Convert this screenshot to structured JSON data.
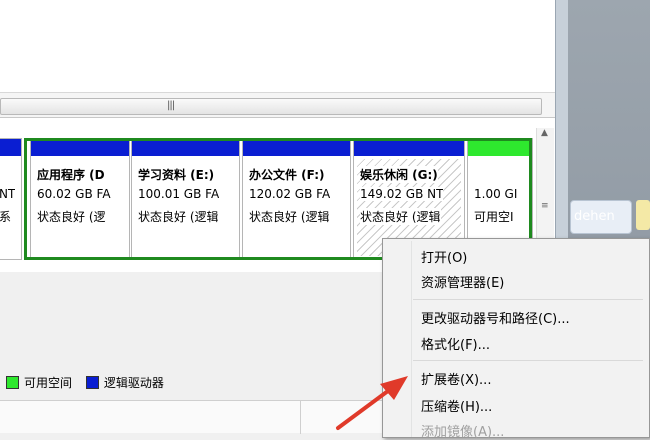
{
  "scrollbar": {
    "grip": "|||"
  },
  "partitions": [
    {
      "name": "",
      "size": "NT",
      "status": "系",
      "bar": "blue",
      "hatched": false
    },
    {
      "name": "应用程序 (D",
      "size": "60.02 GB FA",
      "status": "状态良好 (逻",
      "bar": "blue",
      "hatched": false
    },
    {
      "name": "学习资料 (E:)",
      "size": "100.01 GB FA",
      "status": "状态良好 (逻辑",
      "bar": "blue",
      "hatched": false
    },
    {
      "name": "办公文件 (F:)",
      "size": "120.02 GB FA",
      "status": "状态良好 (逻辑",
      "bar": "blue",
      "hatched": false
    },
    {
      "name": "娱乐休闲 (G:)",
      "size": "149.02 GB NT",
      "status": "状态良好 (逻辑",
      "bar": "blue",
      "hatched": true
    },
    {
      "name": "",
      "size": "1.00 GI",
      "status": "可用空I",
      "bar": "green",
      "hatched": false
    }
  ],
  "legend": {
    "free_space": "可用空间",
    "logical_drive": "逻辑驱动器"
  },
  "chat": {
    "text": "dehen"
  },
  "context_menu": {
    "items": [
      {
        "label": "打开(O)",
        "disabled": false
      },
      {
        "label": "资源管理器(E)",
        "disabled": false
      },
      {
        "label": "更改驱动器号和路径(C)...",
        "disabled": false
      },
      {
        "label": "格式化(F)...",
        "disabled": false
      },
      {
        "label": "扩展卷(X)...",
        "disabled": false
      },
      {
        "label": "压缩卷(H)...",
        "disabled": false
      },
      {
        "label": "添加镜像(A)...",
        "disabled": true
      }
    ]
  },
  "colors": {
    "primary_partition_bar": "#0a1ed2",
    "free_space": "#2ee82e",
    "extended_partition_frame": "#1f8a1f",
    "arrow": "#e03a2a"
  }
}
